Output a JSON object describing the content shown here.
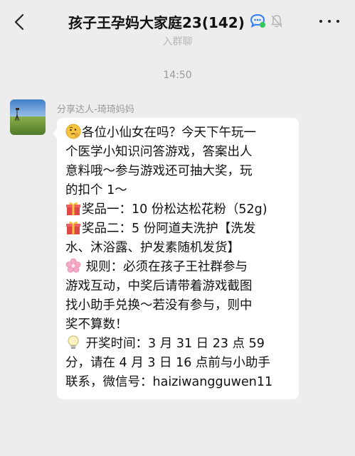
{
  "header": {
    "back_icon": "chevron-left-icon",
    "title": "孩子王孕妈大家庭23(142)",
    "badge_icon": "group-chat-icon",
    "mute_icon": "mute-bell-icon",
    "more_icon": "more-dots-icon"
  },
  "notice": {
    "text": "入群聊"
  },
  "timestamp": "14:50",
  "message": {
    "sender": "分享达人-琦琦妈妈",
    "avatar_icon": "grassland-avatar",
    "lines": [
      {
        "emoji": "thinking-face-icon",
        "text": "各位小仙女在吗？今天下午玩一"
      },
      {
        "emoji": null,
        "text": "个医学小知识问答游戏，答案出人"
      },
      {
        "emoji": null,
        "text": "意料哦～参与游戏还可抽大奖，玩"
      },
      {
        "emoji": null,
        "text": "的扣个 1～"
      },
      {
        "emoji": "gift-icon",
        "text": "奖品一：10 份松达松花粉（52g)"
      },
      {
        "emoji": "gift-icon",
        "text": "奖品二：5 份阿道夫洗护【洗发"
      },
      {
        "emoji": null,
        "text": "水、沐浴露、护发素随机发货】"
      },
      {
        "emoji": "cherry-blossom-icon",
        "text": " 规则：必须在孩子王社群参与"
      },
      {
        "emoji": null,
        "text": "游戏互动，中奖后请带着游戏截图"
      },
      {
        "emoji": null,
        "text": "找小助手兑换～若没有参与，则中"
      },
      {
        "emoji": null,
        "text": "奖不算数！"
      },
      {
        "emoji": "light-bulb-icon",
        "text": " 开奖时间：3 月 31 日 23 点 59"
      },
      {
        "emoji": null,
        "text": "分，请在 4 月 3 日 16 点前与小助手"
      },
      {
        "emoji": null,
        "text": "联系，微信号：haiziwangguwen11"
      }
    ]
  },
  "colors": {
    "background": "#ededed",
    "bubble": "#ffffff",
    "meta_text": "#9a9a9a",
    "badge_blue": "#3b82f6"
  }
}
